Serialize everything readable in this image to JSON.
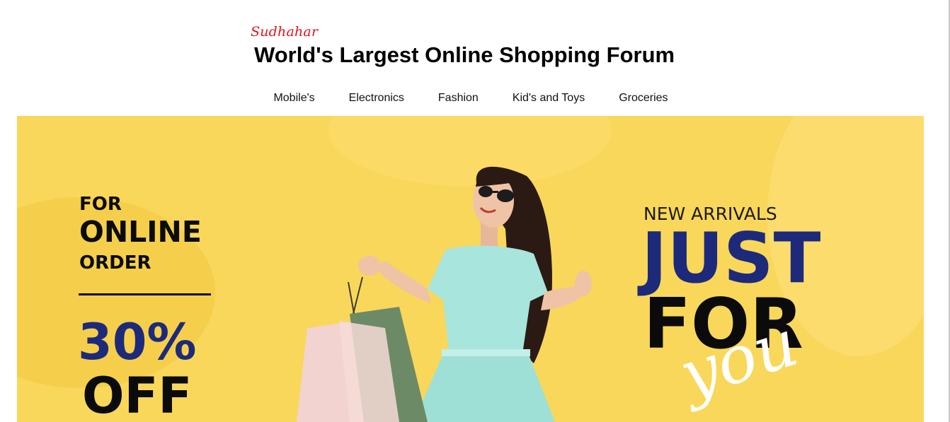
{
  "header": {
    "brand": "Sudhahar",
    "title": "World's Largest Online Shopping Forum"
  },
  "nav": {
    "items": [
      {
        "label": "Mobile's"
      },
      {
        "label": "Electronics"
      },
      {
        "label": "Fashion"
      },
      {
        "label": "Kid's and Toys"
      },
      {
        "label": "Groceries"
      }
    ]
  },
  "banner": {
    "left_line1": "FOR",
    "left_line2": "ONLINE",
    "left_line3": "ORDER",
    "discount": "30%",
    "off": "OFF",
    "right_top": "NEW ARRIVALS",
    "right_big1": "JUST",
    "right_big2": "FOR",
    "right_script": "you",
    "colors": {
      "background": "#f9d75a",
      "navy": "#1d2a7b",
      "black": "#0b0b0b"
    }
  }
}
